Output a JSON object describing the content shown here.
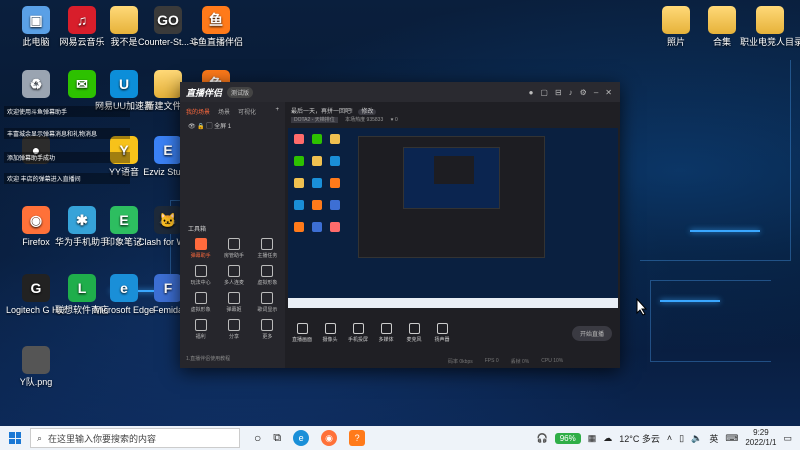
{
  "desktop_icons": [
    {
      "label": "此电脑",
      "color": "#5aa0e6",
      "glyph": "▣"
    },
    {
      "label": "网易云音乐",
      "color": "#d81e2b",
      "glyph": "♫"
    },
    {
      "label": "我不是",
      "color": "#f0c050",
      "glyph": ""
    },
    {
      "label": "Counter-St... Global Off...",
      "color": "#3a3a3a",
      "glyph": "GO"
    },
    {
      "label": "斗鱼直播伴侣",
      "color": "#ff7a1a",
      "glyph": "鱼"
    },
    {
      "label": "",
      "color": "#9aa4b1",
      "glyph": "♻"
    },
    {
      "label": "",
      "color": "#2dc100",
      "glyph": "✉"
    },
    {
      "label": "网易UU加速器",
      "color": "#0c8ed9",
      "glyph": "U"
    },
    {
      "label": "新建文件夹",
      "color": "#f0c050",
      "glyph": ""
    },
    {
      "label": "",
      "color": "#ff7a1a",
      "glyph": "鱼"
    },
    {
      "label": "",
      "color": "#2c2c2c",
      "glyph": "●"
    },
    {
      "label": "YY语音",
      "color": "#f7c21a",
      "glyph": "Y"
    },
    {
      "label": "Ezviz Studio",
      "color": "#3b82f6",
      "glyph": "E"
    },
    {
      "label": "Firefox",
      "color": "#ff7139",
      "glyph": "◉"
    },
    {
      "label": "华为手机助手",
      "color": "#36a3d9",
      "glyph": "✱"
    },
    {
      "label": "印象笔记",
      "color": "#2dbe60",
      "glyph": "E"
    },
    {
      "label": "Clash for Windows",
      "color": "#1e2a3a",
      "glyph": "🐱"
    },
    {
      "label": "Logitech G HUB",
      "color": "#222",
      "glyph": "G"
    },
    {
      "label": "联想软件商店",
      "color": "#1fae4b",
      "glyph": "L"
    },
    {
      "label": "Microsoft Edge",
      "color": "#1a8fd8",
      "glyph": "e"
    },
    {
      "label": "Femida",
      "color": "#3d6fd4",
      "glyph": "F"
    },
    {
      "label": "Y队.png",
      "color": "#555",
      "glyph": ""
    },
    {
      "label": "照片",
      "color": "#f0c050",
      "glyph": ""
    },
    {
      "label": "合集",
      "color": "#f0c050",
      "glyph": ""
    },
    {
      "label": "职业电竞人目录",
      "color": "#f0c050",
      "glyph": ""
    }
  ],
  "notifications": [
    "欢迎使用斗鱼弹幕助手",
    "丰富城余显示弹幕消息和礼物消息",
    "添加弹幕助手成功",
    "欢迎 丰店的弹幕进入直播间"
  ],
  "app": {
    "name": "直播伴侣",
    "version": "测试版",
    "tabs": [
      "我的场景",
      "场景",
      "可视化"
    ],
    "scene_label": "全屏 1",
    "tools_title": "工具箱",
    "tools": [
      {
        "label": "弹幕助手",
        "active": true
      },
      {
        "label": "房管助手",
        "active": false
      },
      {
        "label": "主播任务",
        "active": false
      },
      {
        "label": "玩法中心",
        "active": false
      },
      {
        "label": "多人连麦",
        "active": false
      },
      {
        "label": "虚拟形象",
        "active": false
      },
      {
        "label": "虚拟形象",
        "active": false
      },
      {
        "label": "弹幕姬",
        "active": false
      },
      {
        "label": "歌词显示",
        "active": false
      },
      {
        "label": "福利",
        "active": false
      },
      {
        "label": "分享",
        "active": false
      },
      {
        "label": "更多",
        "active": false
      }
    ],
    "footer": "1.直播伴侣使用教程",
    "header_title": "最后一天，再拼一回吧!",
    "header_tag": "修改",
    "game_tag": "DOTA2 - 天梯排位",
    "room_label": "本场热度",
    "room_value": "935833",
    "likes": "0",
    "controls": [
      "直播画面",
      "摄像头",
      "手机投屏",
      "多媒体",
      "麦克风",
      "扬声器"
    ],
    "start_button": "开始直播",
    "status": [
      "码率 0kbps",
      "FPS 0",
      "丢帧 0%",
      "CPU 10%"
    ]
  },
  "taskbar": {
    "search_placeholder": "在这里输入你要搜索的内容",
    "battery": "96%",
    "weather": "12°C 多云",
    "ime": "英",
    "time": "9:29",
    "date": "2022/1/1"
  }
}
